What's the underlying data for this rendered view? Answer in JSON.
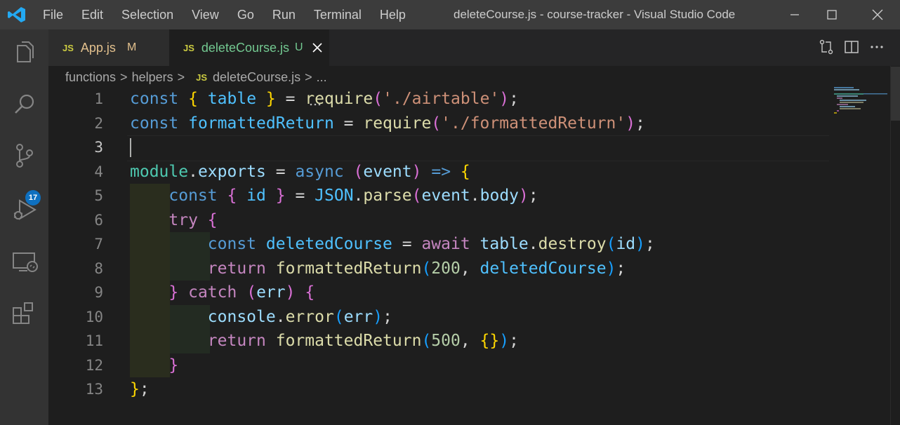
{
  "menu": [
    "File",
    "Edit",
    "Selection",
    "View",
    "Go",
    "Run",
    "Terminal",
    "Help"
  ],
  "window_title": "deleteCourse.js - course-tracker - Visual Studio Code",
  "activity": {
    "scm_badge": "17",
    "icons": [
      "explorer-icon",
      "search-icon",
      "source-control-icon",
      "run-debug-icon",
      "remote-explorer-icon",
      "extensions-icon"
    ]
  },
  "tabs": [
    {
      "file_type": "JS",
      "name": "App.js",
      "status": "M",
      "active": false
    },
    {
      "file_type": "JS",
      "name": "deleteCourse.js",
      "status": "U",
      "active": true
    }
  ],
  "breadcrumb": {
    "folder1": "functions",
    "folder2": "helpers",
    "file_type": "JS",
    "file": "deleteCourse.js",
    "more": "...",
    "separator": ">"
  },
  "editor": {
    "active_line": 3,
    "line_numbers": [
      "1",
      "2",
      "3",
      "4",
      "5",
      "6",
      "7",
      "8",
      "9",
      "10",
      "11",
      "12",
      "13"
    ],
    "lines": [
      [
        [
          "const ",
          "k-blue"
        ],
        [
          "{",
          "b1"
        ],
        [
          " ",
          "op"
        ],
        [
          "table",
          "v-const"
        ],
        [
          " ",
          "op"
        ],
        [
          "}",
          "b1"
        ],
        [
          " = ",
          "op"
        ],
        [
          "require",
          "fn"
        ],
        [
          "(",
          "b2"
        ],
        [
          "'./airtable'",
          "str"
        ],
        [
          ")",
          "b2"
        ],
        [
          ";",
          "op"
        ]
      ],
      [
        [
          "const ",
          "k-blue"
        ],
        [
          "formattedReturn",
          "v-const"
        ],
        [
          " = ",
          "op"
        ],
        [
          "require",
          "fn"
        ],
        [
          "(",
          "b2"
        ],
        [
          "'./formattedReturn'",
          "str"
        ],
        [
          ")",
          "b2"
        ],
        [
          ";",
          "op"
        ]
      ],
      [],
      [
        [
          "module",
          "cls"
        ],
        [
          ".",
          "op"
        ],
        [
          "exports",
          "v-light"
        ],
        [
          " = ",
          "op"
        ],
        [
          "async ",
          "k-blue"
        ],
        [
          "(",
          "b2"
        ],
        [
          "event",
          "v-light"
        ],
        [
          ")",
          "b2"
        ],
        [
          " ",
          "op"
        ],
        [
          "=>",
          "k-blue"
        ],
        [
          " ",
          "op"
        ],
        [
          "{",
          "b1"
        ]
      ],
      [
        [
          "    ",
          "op"
        ],
        [
          "const ",
          "k-blue"
        ],
        [
          "{",
          "b2"
        ],
        [
          " ",
          "op"
        ],
        [
          "id",
          "v-const"
        ],
        [
          " ",
          "op"
        ],
        [
          "}",
          "b2"
        ],
        [
          " = ",
          "op"
        ],
        [
          "JSON",
          "v-const"
        ],
        [
          ".",
          "op"
        ],
        [
          "parse",
          "fn"
        ],
        [
          "(",
          "b2"
        ],
        [
          "event",
          "v-light"
        ],
        [
          ".",
          "op"
        ],
        [
          "body",
          "v-light"
        ],
        [
          ")",
          "b2"
        ],
        [
          ";",
          "op"
        ]
      ],
      [
        [
          "    ",
          "op"
        ],
        [
          "try ",
          "k-purple"
        ],
        [
          "{",
          "b2"
        ]
      ],
      [
        [
          "        ",
          "op"
        ],
        [
          "const ",
          "k-blue"
        ],
        [
          "deletedCourse",
          "v-const"
        ],
        [
          " = ",
          "op"
        ],
        [
          "await ",
          "k-purple"
        ],
        [
          "table",
          "v-light"
        ],
        [
          ".",
          "op"
        ],
        [
          "destroy",
          "fn"
        ],
        [
          "(",
          "b3"
        ],
        [
          "id",
          "v-light"
        ],
        [
          ")",
          "b3"
        ],
        [
          ";",
          "op"
        ]
      ],
      [
        [
          "        ",
          "op"
        ],
        [
          "return ",
          "k-purple"
        ],
        [
          "formattedReturn",
          "fn"
        ],
        [
          "(",
          "b3"
        ],
        [
          "200",
          "num"
        ],
        [
          ", ",
          "op"
        ],
        [
          "deletedCourse",
          "v-const"
        ],
        [
          ")",
          "b3"
        ],
        [
          ";",
          "op"
        ]
      ],
      [
        [
          "    ",
          "op"
        ],
        [
          "}",
          "b2"
        ],
        [
          " ",
          "op"
        ],
        [
          "catch ",
          "k-purple"
        ],
        [
          "(",
          "b2"
        ],
        [
          "err",
          "v-light"
        ],
        [
          ")",
          "b2"
        ],
        [
          " ",
          "op"
        ],
        [
          "{",
          "b2"
        ]
      ],
      [
        [
          "        ",
          "op"
        ],
        [
          "console",
          "v-light"
        ],
        [
          ".",
          "op"
        ],
        [
          "error",
          "fn"
        ],
        [
          "(",
          "b3"
        ],
        [
          "err",
          "v-light"
        ],
        [
          ")",
          "b3"
        ],
        [
          ";",
          "op"
        ]
      ],
      [
        [
          "        ",
          "op"
        ],
        [
          "return ",
          "k-purple"
        ],
        [
          "formattedReturn",
          "fn"
        ],
        [
          "(",
          "b3"
        ],
        [
          "500",
          "num"
        ],
        [
          ", ",
          "op"
        ],
        [
          "{}",
          "b1"
        ],
        [
          ")",
          "b3"
        ],
        [
          ";",
          "op"
        ]
      ],
      [
        [
          "    ",
          "op"
        ],
        [
          "}",
          "b2"
        ]
      ],
      [
        [
          "}",
          "b1"
        ],
        [
          ";",
          "op"
        ]
      ]
    ]
  },
  "colors": {
    "title_bar": "#3c3c3c",
    "activity_bar": "#333333",
    "editor_bg": "#1e1e1e",
    "badge": "#0e70c0",
    "modified": "#e2c08d",
    "untracked": "#73c991",
    "js_icon": "#cbcb41"
  }
}
